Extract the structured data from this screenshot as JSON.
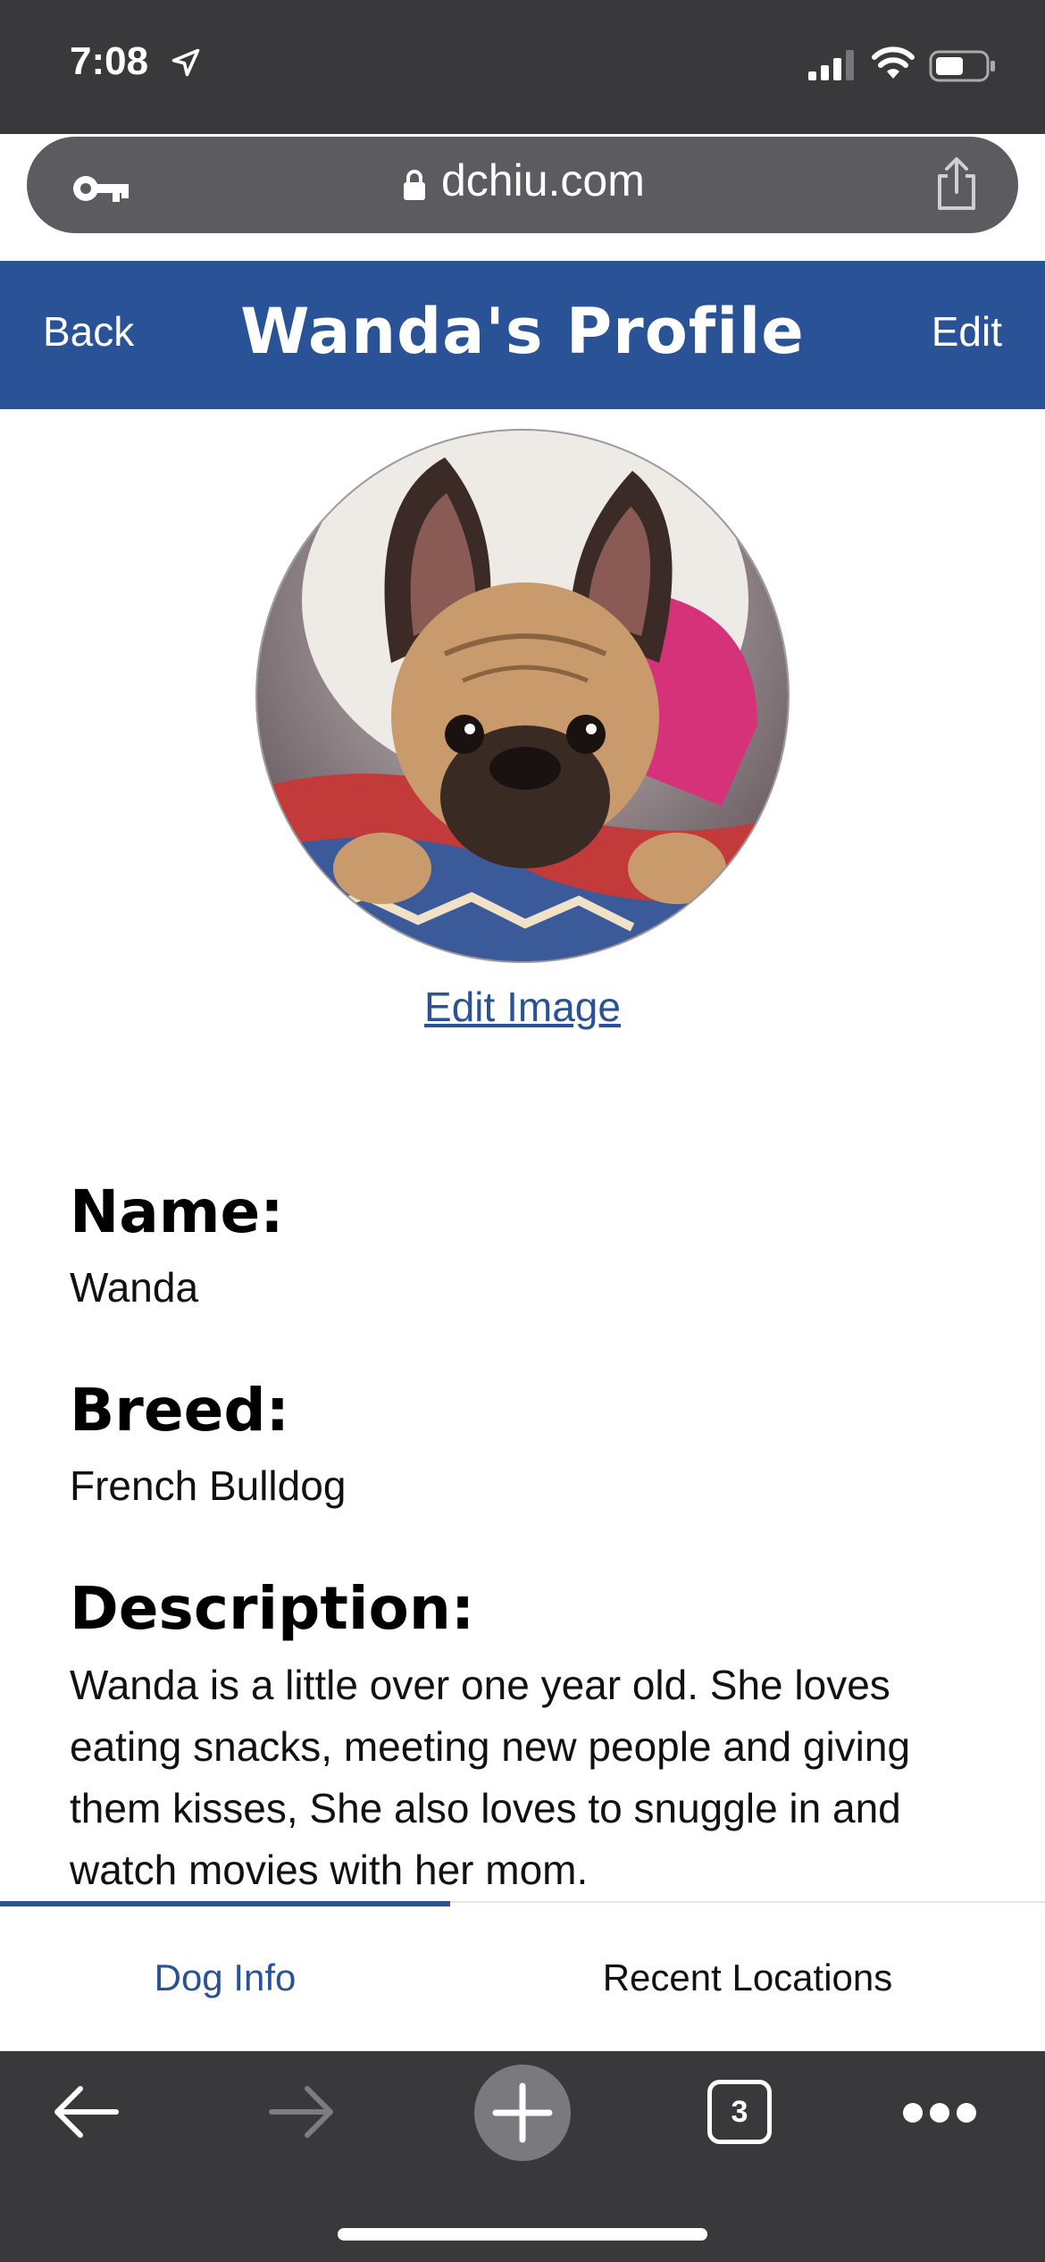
{
  "status_bar": {
    "time": "7:08"
  },
  "browser": {
    "url": "dchiu.com",
    "tab_count": "3"
  },
  "header": {
    "back_label": "Back",
    "title": "Wanda's Profile",
    "edit_label": "Edit"
  },
  "profile": {
    "edit_image_label": "Edit Image",
    "fields": {
      "name_label": "Name:",
      "name_value": "Wanda",
      "breed_label": "Breed:",
      "breed_value": "French Bulldog",
      "description_label": "Description:",
      "description_value": "Wanda is a little over one year old. She loves eating snacks, meeting new people and giving them kisses, She also loves to snuggle in and watch movies with her mom."
    }
  },
  "tabs": [
    {
      "label": "Dog Info",
      "active": true
    },
    {
      "label": "Recent Locations",
      "active": false
    }
  ],
  "colors": {
    "brand_blue": "#2a5296",
    "browser_chrome": "#39393b"
  }
}
